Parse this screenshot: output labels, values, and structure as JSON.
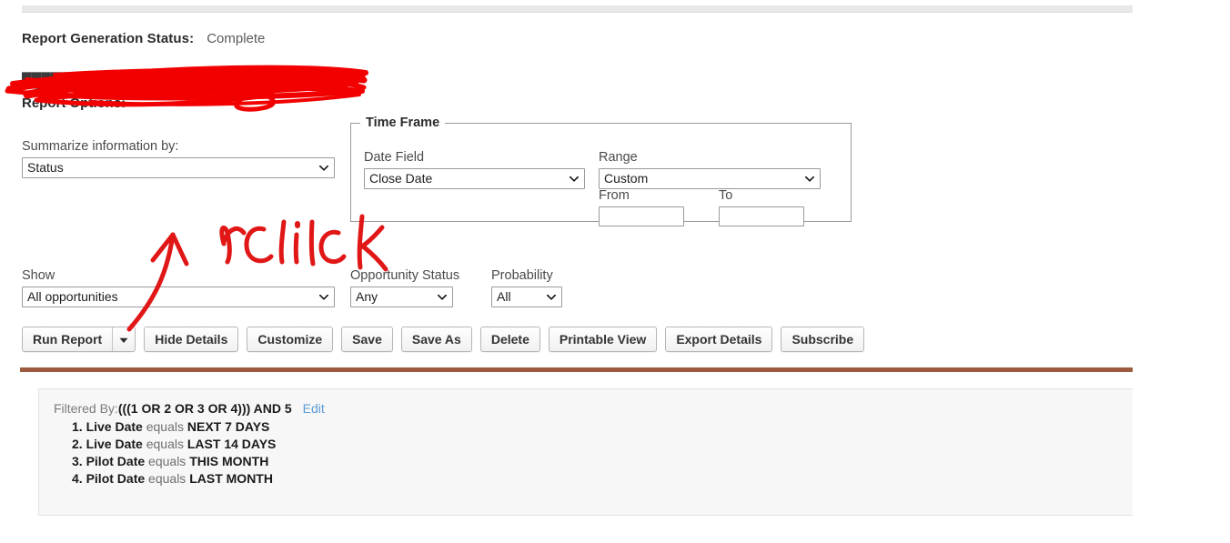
{
  "status": {
    "label": "Report Generation Status:",
    "value": "Complete"
  },
  "redacted_line": {
    "text": "██████ ███ █████████ ████████",
    "note": "obscured by red scribble"
  },
  "report_options_label": "Report Options:",
  "summarize": {
    "label": "Summarize information by:",
    "value": "Status",
    "options": [
      "Status"
    ]
  },
  "time_frame": {
    "legend": "Time Frame",
    "date_field": {
      "label": "Date Field",
      "value": "Close Date",
      "options": [
        "Close Date"
      ]
    },
    "range": {
      "label": "Range",
      "value": "Custom",
      "options": [
        "Custom"
      ]
    },
    "from": {
      "label": "From",
      "value": "",
      "placeholder": ""
    },
    "to": {
      "label": "To",
      "value": "",
      "placeholder": ""
    }
  },
  "show": {
    "label": "Show",
    "value": "All opportunities",
    "options": [
      "All opportunities"
    ]
  },
  "opportunity_status": {
    "label": "Opportunity Status",
    "value": "Any",
    "options": [
      "Any"
    ]
  },
  "probability": {
    "label": "Probability",
    "value": "All",
    "options": [
      "All"
    ]
  },
  "buttons": {
    "run_report": "Run Report",
    "run_report_caret": "▼",
    "hide_details": "Hide Details",
    "customize": "Customize",
    "save": "Save",
    "save_as": "Save As",
    "delete": "Delete",
    "printable_view": "Printable View",
    "export_details": "Export Details",
    "subscribe": "Subscribe"
  },
  "filters": {
    "label": "Filtered By:",
    "expression": "(((1 OR 2 OR 3 OR 4))) AND 5",
    "edit_link": "Edit",
    "rows": [
      {
        "num": "1.",
        "field": "Live Date",
        "operator": "equals",
        "value": "NEXT 7 DAYS"
      },
      {
        "num": "2.",
        "field": "Live Date",
        "operator": "equals",
        "value": "LAST 14 DAYS"
      },
      {
        "num": "3.",
        "field": "Pilot Date",
        "operator": "equals",
        "value": "THIS MONTH"
      },
      {
        "num": "4.",
        "field": "Pilot Date",
        "operator": "equals",
        "value": "LAST MONTH"
      }
    ]
  },
  "annotations": {
    "click_text": "click",
    "ink_color": "#e11717",
    "redaction_color": "#f20000"
  },
  "colors": {
    "panel_accent": "#9c5b3f",
    "link": "#5b9bd5",
    "text": "#222222",
    "muted": "#6f6f6f"
  }
}
